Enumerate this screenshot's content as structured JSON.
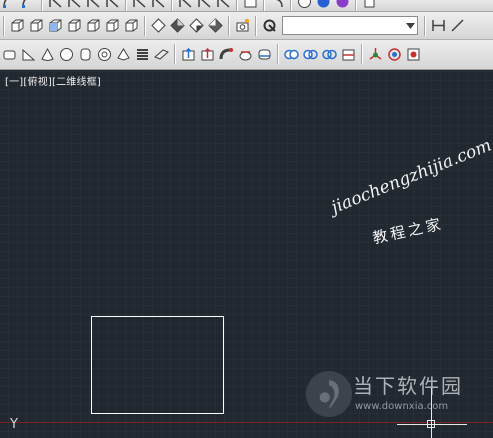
{
  "viewport": {
    "label": "[一][俯视][二维线框]"
  },
  "toolbar_row1": {
    "icons": [
      "arc-icon",
      "arc-icon",
      "dimension-icon",
      "dimension-icon",
      "dimension-icon",
      "dimension-icon",
      "dimension-icon",
      "dimension-icon",
      "dimension-icon",
      "dimension-icon",
      "dimension-icon",
      "screen-icon",
      "undo-icon",
      "circle-x-icon",
      "sphere-blue-icon",
      "sphere-purple-icon",
      "copy-icon"
    ]
  },
  "toolbar_row2": {
    "icons": [
      "box-view-icon",
      "box-view-icon",
      "box-view-icon",
      "box-view-icon",
      "box-view-icon",
      "box-view-icon",
      "box-view-icon",
      "solid-shade-icon",
      "solid-shade-icon",
      "solid-shade-icon",
      "solid-shade-icon",
      "camera-icon",
      "orbit-icon"
    ],
    "combo_value": "",
    "right_icons": [
      "dimension-linear-icon",
      "dimension-aligned-icon"
    ]
  },
  "toolbar_row3": {
    "icons": [
      "box-icon",
      "wedge-icon",
      "cone-icon",
      "sphere-icon",
      "cylinder-icon",
      "torus-icon",
      "pyramid-icon",
      "helix-icon",
      "planar-surface-icon",
      "extrude-icon",
      "presspull-icon",
      "sweep-icon",
      "revolve-icon",
      "loft-icon",
      "union-icon",
      "subtract-icon",
      "intersect-icon",
      "slice-icon",
      "3d-move-icon",
      "3d-rotate-icon",
      "3d-align-icon"
    ]
  },
  "canvas": {
    "background": "#212830",
    "entity_color": "#ffffff",
    "ucs_y": "Y"
  },
  "watermark": {
    "line1": "jiaochengzhijia.com",
    "line2": "教程之家",
    "brand": "当下软件园",
    "url": "www.downxia.com"
  }
}
